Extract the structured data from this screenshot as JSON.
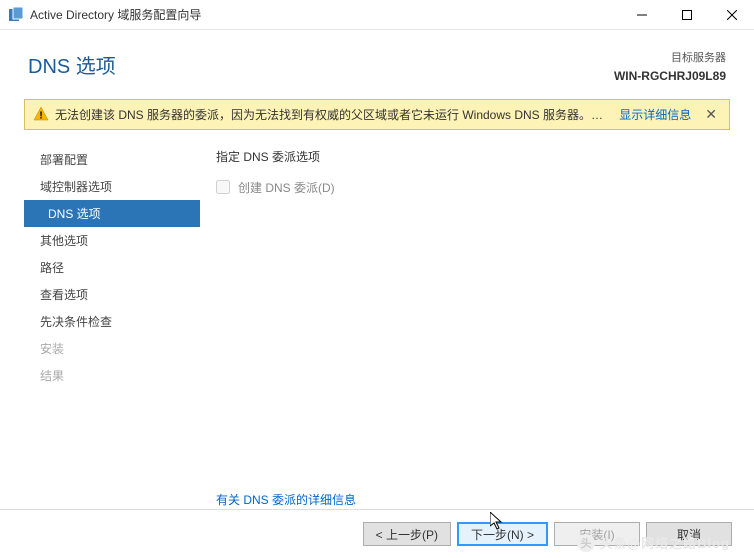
{
  "window": {
    "title": "Active Directory 域服务配置向导"
  },
  "header": {
    "pageTitle": "DNS 选项",
    "targetLabel": "目标服务器",
    "hostname": "WIN-RGCHRJ09L89"
  },
  "warning": {
    "text": "无法创建该 DNS 服务器的委派，因为无法找到有权威的父区域或者它未运行 Windows DNS 服务器。如...",
    "linkText": "显示详细信息"
  },
  "sidebar": {
    "items": [
      {
        "label": "部署配置",
        "state": "normal"
      },
      {
        "label": "域控制器选项",
        "state": "normal"
      },
      {
        "label": "DNS 选项",
        "state": "active"
      },
      {
        "label": "其他选项",
        "state": "normal"
      },
      {
        "label": "路径",
        "state": "normal"
      },
      {
        "label": "查看选项",
        "state": "normal"
      },
      {
        "label": "先决条件检查",
        "state": "normal"
      },
      {
        "label": "安装",
        "state": "disabled"
      },
      {
        "label": "结果",
        "state": "disabled"
      }
    ]
  },
  "content": {
    "heading": "指定 DNS 委派选项",
    "checkboxLabel": "创建 DNS 委派(D)",
    "infoLink": "有关 DNS 委派的详细信息"
  },
  "buttons": {
    "prev": "< 上一步(P)",
    "next": "下一步(N) >",
    "install": "安装(I)",
    "cancel": "取消"
  },
  "watermark": "头条@网络之路Blog"
}
